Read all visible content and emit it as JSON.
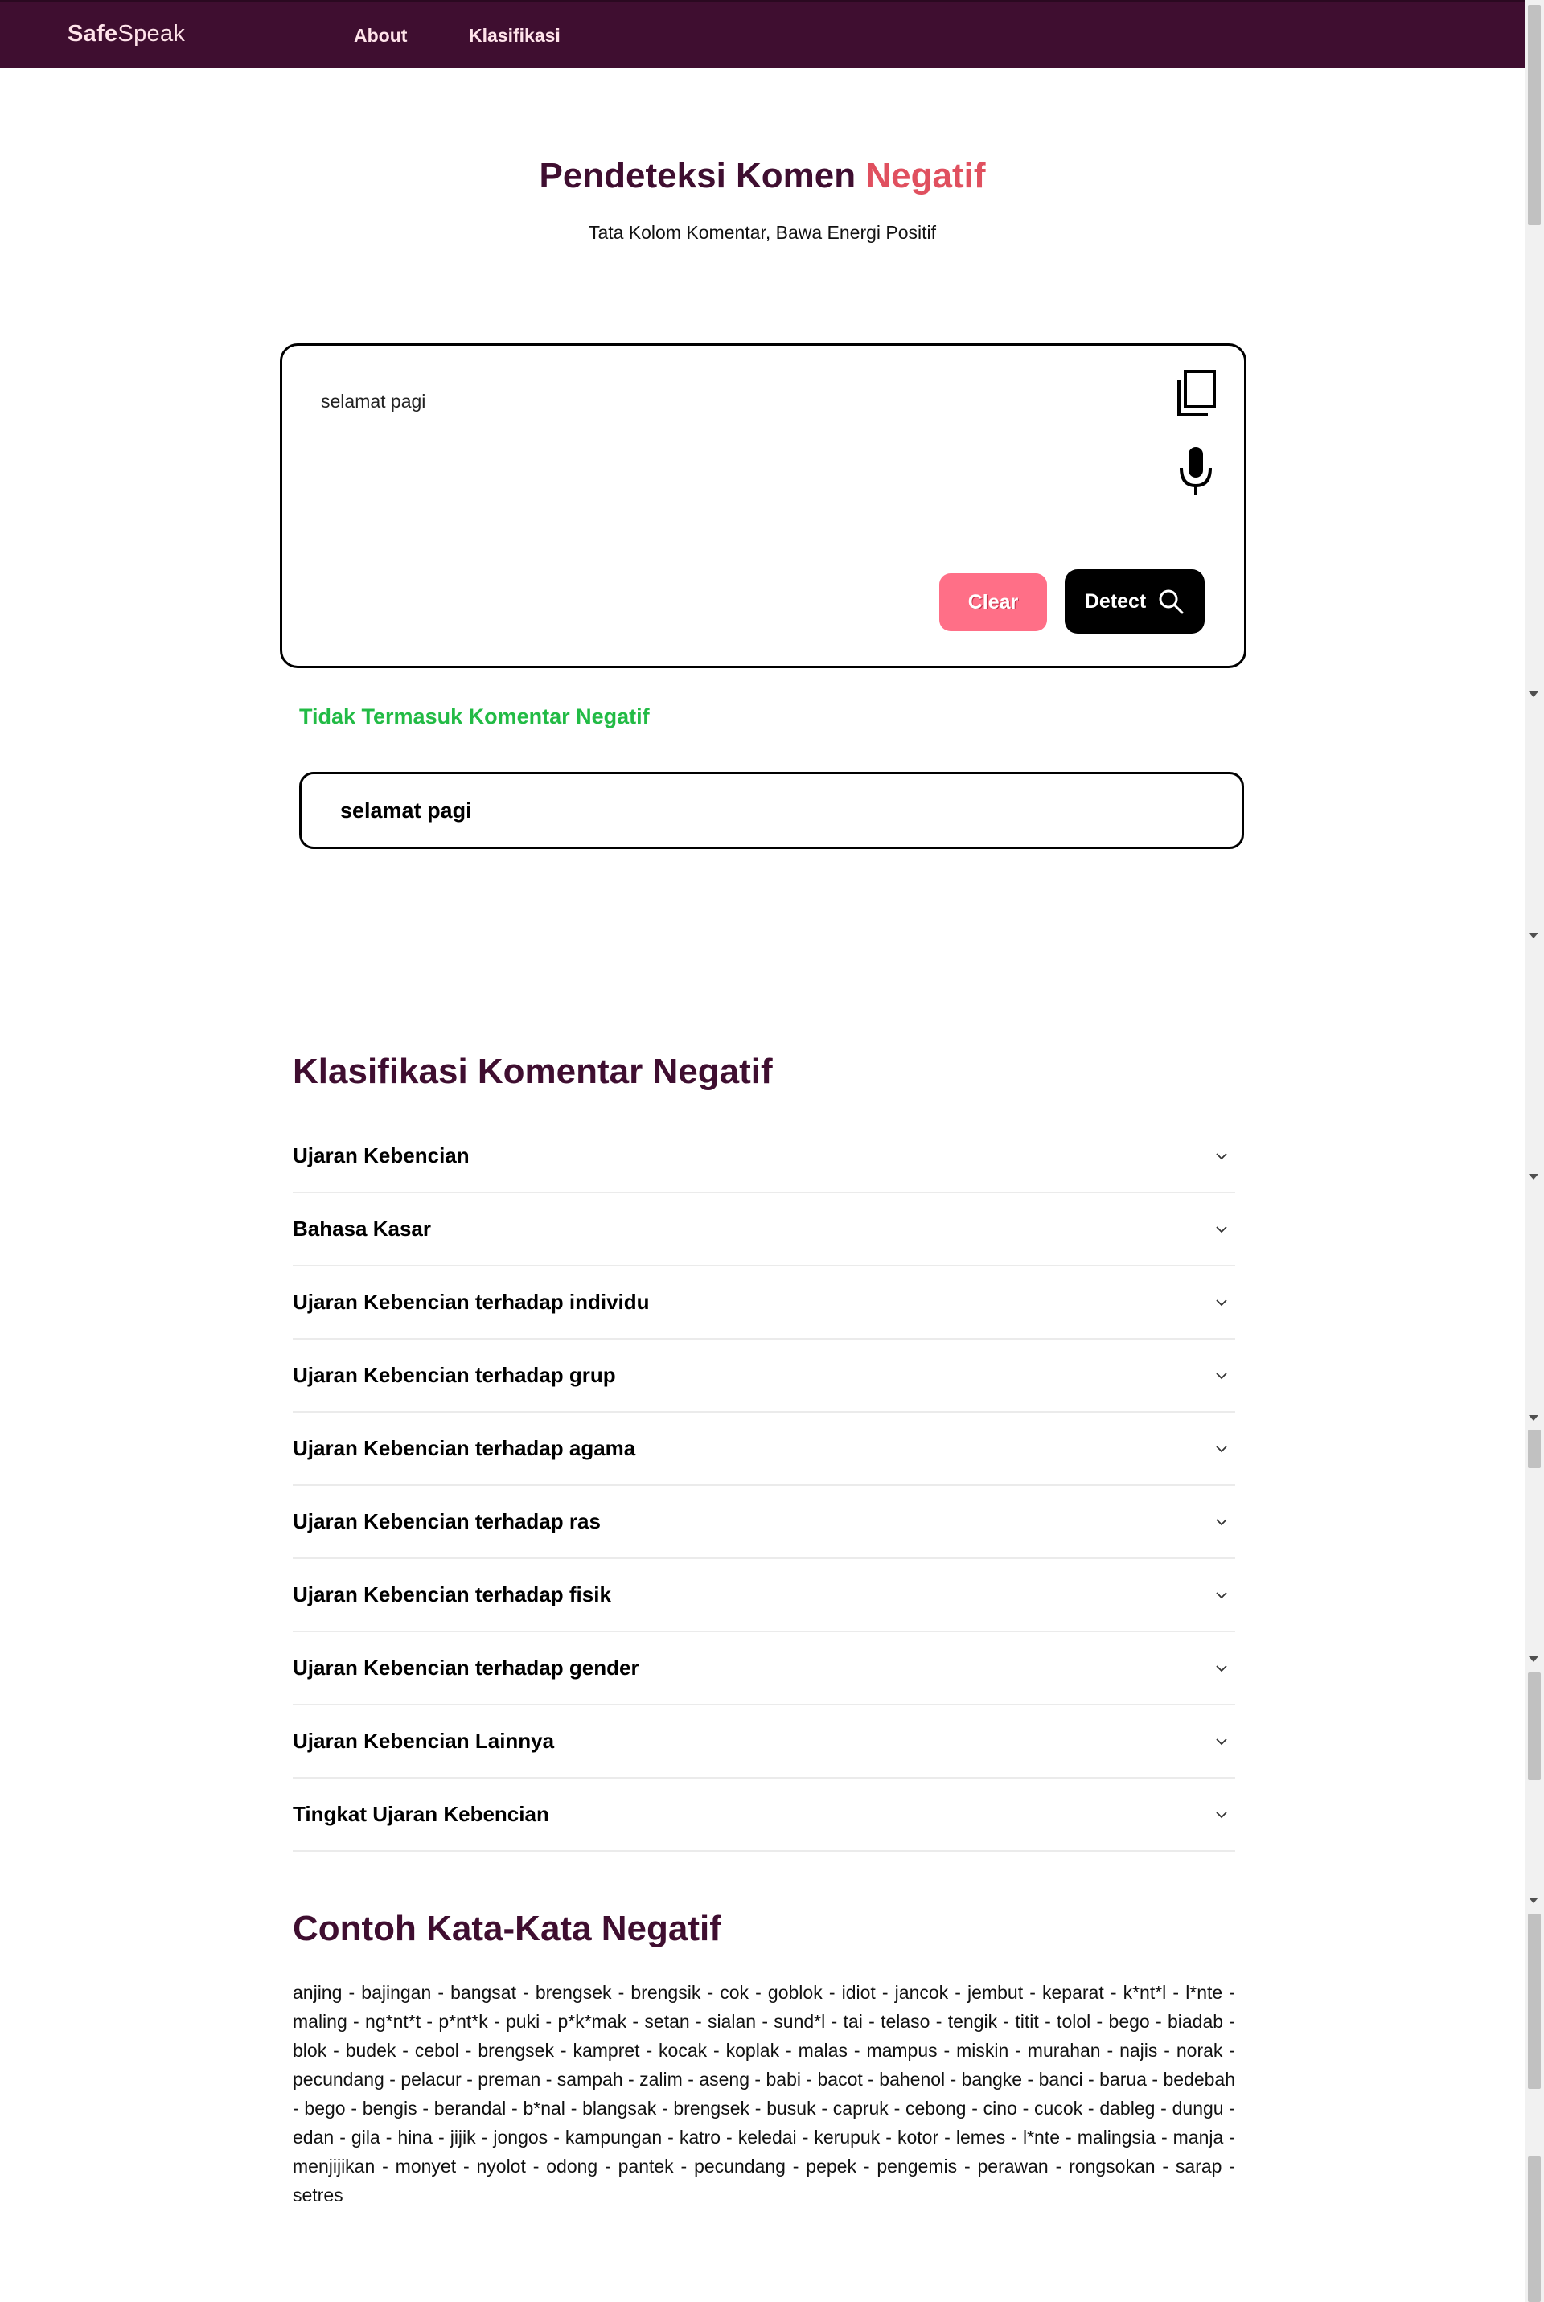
{
  "nav": {
    "brand_bold": "Safe",
    "brand_light": "Speak",
    "links": [
      "About",
      "Klasifikasi"
    ]
  },
  "hero": {
    "title_main": "Pendeteksi Komen",
    "title_accent": "Negatif",
    "subtitle": "Tata Kolom Komentar, Bawa Energi Positif"
  },
  "input": {
    "value": "selamat pagi",
    "clear_label": "Clear",
    "detect_label": "Detect",
    "icons": [
      "copy-icon",
      "microphone-icon",
      "search-icon"
    ]
  },
  "result": {
    "label": "Tidak Termasuk Komentar Negatif",
    "text": "selamat pagi"
  },
  "klasifikasi": {
    "title": "Klasifikasi Komentar Negatif",
    "items": [
      "Ujaran Kebencian",
      "Bahasa Kasar",
      "Ujaran Kebencian terhadap individu",
      "Ujaran Kebencian terhadap grup",
      "Ujaran Kebencian terhadap agama",
      "Ujaran Kebencian terhadap ras",
      "Ujaran Kebencian terhadap fisik",
      "Ujaran Kebencian terhadap gender",
      "Ujaran Kebencian Lainnya",
      "Tingkat Ujaran Kebencian"
    ]
  },
  "contoh": {
    "title": "Contoh Kata-Kata Negatif",
    "text": "anjing - bajingan - bangsat - brengsek - brengsik - cok - goblok - idiot - jancok - jembut - keparat - k*nt*l - l*nte - maling - ng*nt*t - p*nt*k - puki - p*k*mak - setan - sialan - sund*l - tai - telaso - tengik - titit - tolol - bego - biadab - blok - budek - cebol - brengsek - kampret - kocak - koplak - malas - mampus - miskin - murahan - najis - norak - pecundang - pelacur - preman - sampah - zalim - aseng - babi - bacot - bahenol - bangke - banci - barua - bedebah - bego - bengis - berandal - b*nal - blangsak - brengsek - busuk - capruk - cebong - cino - cucok - dableg - dungu - edan - gila - hina - jijik - jongos - kampungan - katro - keledai - kerupuk - kotor - lemes - l*nte - malingsia - manja - menjijikan - monyet - nyolot - odong - pantek - pecundang - pepek - pengemis - perawan - rongsokan - sarap - setres"
  },
  "colors": {
    "primary": "#3f0e30",
    "accent": "#e0505f",
    "success": "#22bb45",
    "clear": "#ff6f87"
  }
}
